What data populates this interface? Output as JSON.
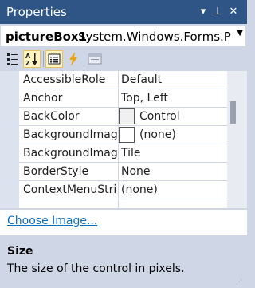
{
  "window": {
    "title": "Properties",
    "buttons": {
      "dropdown": "▾",
      "pin": "⊥",
      "close": "✕"
    }
  },
  "object_selector": {
    "name": "pictureBox1",
    "type": "System.Windows.Forms.Pictu"
  },
  "toolbar": {
    "items": [
      "categorized-icon",
      "alphabetical-icon",
      "properties-icon",
      "events-icon",
      "property-pages-icon"
    ]
  },
  "properties": [
    {
      "name": "AccessibleRole",
      "value": "Default"
    },
    {
      "name": "Anchor",
      "value": "Top, Left"
    },
    {
      "name": "BackColor",
      "value": "Control",
      "swatch": "#f0f0f0"
    },
    {
      "name": "BackgroundImage",
      "value": "(none)",
      "swatch": "#ffffff"
    },
    {
      "name": "BackgroundImageLayout",
      "value": "Tile"
    },
    {
      "name": "BorderStyle",
      "value": "None"
    },
    {
      "name": "ContextMenuStrip",
      "value": "(none)"
    }
  ],
  "verbs": {
    "choose_image": "Choose Image..."
  },
  "description": {
    "title": "Size",
    "text": "The size of the control in pixels."
  },
  "colors": {
    "title_bar": "#2f5486",
    "panel": "#cfd6e5",
    "link": "#0e70c0",
    "active_tool": "#fdf4bf"
  }
}
